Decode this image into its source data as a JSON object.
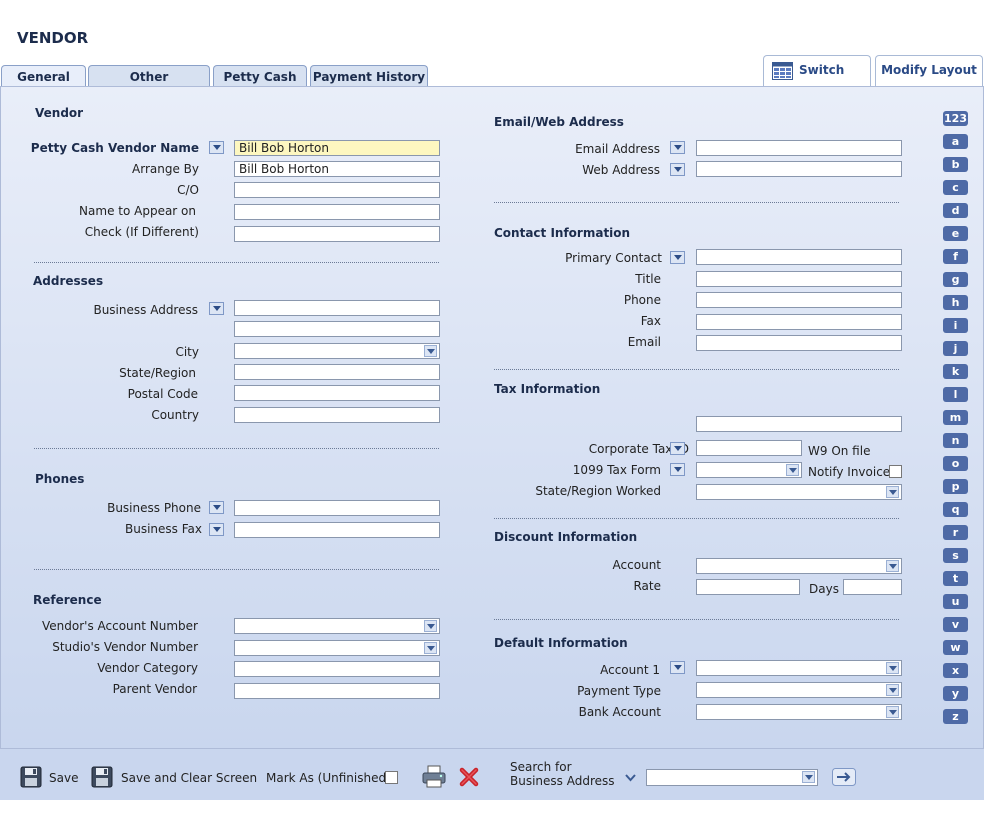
{
  "page": {
    "title": "VENDOR"
  },
  "tabs": [
    "General",
    "Other Information",
    "Petty Cash",
    "Payment History"
  ],
  "top_buttons": {
    "switch_view": "Switch View",
    "modify_layout": "Modify Layout"
  },
  "vendor": {
    "heading": "Vendor",
    "petty_cash_vendor_name": {
      "label": "Petty Cash Vendor Name",
      "value": "Bill Bob Horton"
    },
    "arrange_by": {
      "label": "Arrange By",
      "value": "Bill Bob Horton"
    },
    "co": {
      "label": "C/O",
      "value": ""
    },
    "name_to_appear_on": {
      "label": "Name to Appear on",
      "value": ""
    },
    "check": {
      "label": "Check (If Different)",
      "value": ""
    }
  },
  "addresses": {
    "heading": "Addresses",
    "business_address": {
      "label": "Business Address",
      "value": "",
      "value2": ""
    },
    "city": {
      "label": "City",
      "value": ""
    },
    "state_region": {
      "label": "State/Region",
      "value": ""
    },
    "postal_code": {
      "label": "Postal Code",
      "value": ""
    },
    "country": {
      "label": "Country",
      "value": ""
    }
  },
  "phones": {
    "heading": "Phones",
    "business_phone": {
      "label": "Business Phone",
      "value": ""
    },
    "business_fax": {
      "label": "Business Fax",
      "value": ""
    }
  },
  "reference": {
    "heading": "Reference",
    "vendors_account_number": {
      "label": "Vendor's Account Number",
      "value": ""
    },
    "studios_vendor_number": {
      "label": "Studio's Vendor Number",
      "value": ""
    },
    "vendor_category": {
      "label": "Vendor Category",
      "value": ""
    },
    "parent_vendor": {
      "label": "Parent Vendor",
      "value": ""
    }
  },
  "email_web": {
    "heading": "Email/Web Address",
    "email_address": {
      "label": "Email Address",
      "value": ""
    },
    "web_address": {
      "label": "Web Address",
      "value": ""
    }
  },
  "contact": {
    "heading": "Contact Information",
    "primary_contact": {
      "label": "Primary Contact",
      "value": ""
    },
    "title": {
      "label": "Title",
      "value": ""
    },
    "phone": {
      "label": "Phone",
      "value": ""
    },
    "fax": {
      "label": "Fax",
      "value": ""
    },
    "email": {
      "label": "Email",
      "value": ""
    }
  },
  "tax": {
    "heading": "Tax Information",
    "blank_field": "",
    "corporate_tax_id": {
      "label": "Corporate Tax ID",
      "value": ""
    },
    "w9_label": "W9 On file",
    "tax_1099_form": {
      "label": "1099 Tax Form",
      "value": ""
    },
    "notify_invoice_label": "Notify Invoice",
    "state_region_worked": {
      "label": "State/Region Worked",
      "value": ""
    }
  },
  "discount": {
    "heading": "Discount Information",
    "account": {
      "label": "Account",
      "value": ""
    },
    "rate": {
      "label": "Rate",
      "value": ""
    },
    "days": {
      "label": "Days",
      "value": ""
    }
  },
  "default_info": {
    "heading": "Default Information",
    "account1": {
      "label": "Account 1",
      "value": ""
    },
    "payment_type": {
      "label": "Payment Type",
      "value": ""
    },
    "bank_account": {
      "label": "Bank Account",
      "value": ""
    }
  },
  "alpha_index": [
    "123",
    "a",
    "b",
    "c",
    "d",
    "e",
    "f",
    "g",
    "h",
    "i",
    "j",
    "k",
    "l",
    "m",
    "n",
    "o",
    "p",
    "q",
    "r",
    "s",
    "t",
    "u",
    "v",
    "w",
    "x",
    "y",
    "z"
  ],
  "bottom": {
    "save": "Save",
    "save_clear": "Save and Clear Screen",
    "mark_as": "Mark As (Unfinished)",
    "search_for": "Search for",
    "search_field": "Business Address",
    "search_value": ""
  },
  "colors": {
    "accent": "#4e6aa6",
    "panel": "#dbe4f5",
    "highlight": "#fdf7c0"
  }
}
